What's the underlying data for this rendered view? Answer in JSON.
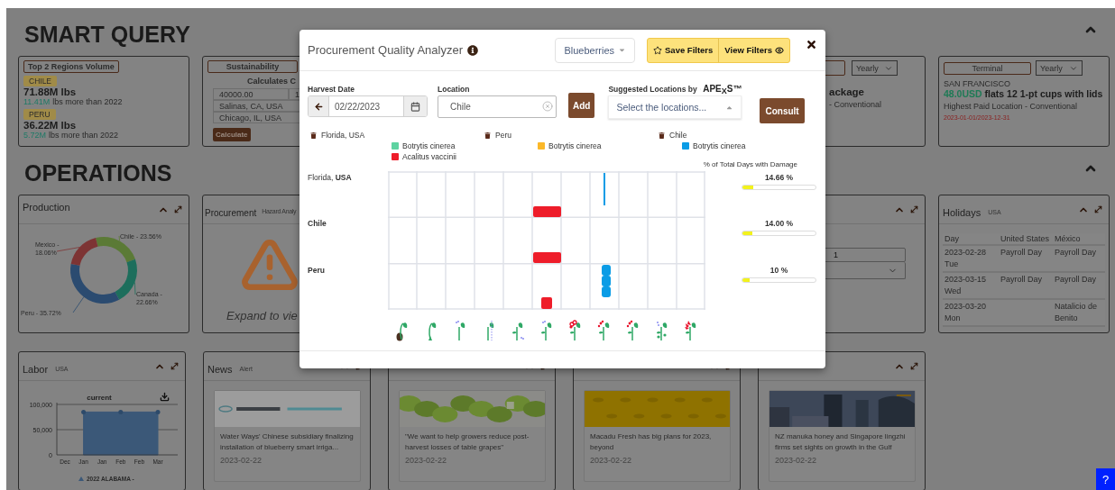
{
  "smart_query": {
    "title": "SMART QUERY",
    "volume_card": {
      "title": "Top 2 Regions Volume",
      "regions": [
        {
          "name": "CHILE",
          "volume": "71.88M lbs",
          "change": "11.41M",
          "change_text": "lbs more than 2022"
        },
        {
          "name": "PERU",
          "volume": "36.22M lbs",
          "change": "5.72M",
          "change_text": "lbs more than 2022"
        }
      ]
    },
    "sustainability_card": {
      "title": "Sustainability",
      "heading": "Calculates C",
      "amount": "40000.00",
      "count": "1",
      "origin": "Salinas, CA, USA",
      "destination": "Chicago, IL, USA",
      "button": "Calculate"
    },
    "package_card": {
      "period": "Yearly",
      "headline": "ackage",
      "subline": "- Conventional"
    },
    "terminal_card": {
      "title": "Terminal",
      "period": "Yearly",
      "city": "SAN FRANCISCO",
      "price": "48.0USD",
      "product": "flats 12 1-pt cups with lids",
      "subline": "Highest Paid Location - Conventional",
      "dates": "2023-01-01/2023-12-31"
    }
  },
  "operations": {
    "title": "OPERATIONS",
    "production": {
      "title": "Production",
      "label_separator": "-",
      "chart_data": {
        "type": "donut",
        "categories": [
          "Chile",
          "Canada",
          "Peru",
          "Mexico"
        ],
        "values": [
          23.56,
          22.66,
          35.72,
          18.06
        ],
        "value_labels": [
          "23.56%",
          "22.66%",
          "35.72%",
          "18.06%"
        ]
      }
    },
    "procurement": {
      "title": "Procurement",
      "subtitle": "Hazard Analy",
      "hint": "Expand to vie"
    },
    "settings_card": {
      "value": "1"
    },
    "holidays": {
      "title": "Holidays",
      "subtitle": "USA",
      "columns": [
        "Day",
        "United States",
        "México"
      ],
      "rows": [
        {
          "day": "2023-02-28 Tue",
          "united_states": "Payroll Day",
          "mexico": "Payroll Day"
        },
        {
          "day": "2023-03-15 Wed",
          "united_states": "Payroll Day",
          "mexico": "Payroll Day"
        },
        {
          "day": "2023-03-20 Mon",
          "mexico": "Natalicio de Benito"
        }
      ]
    }
  },
  "labor": {
    "title": "Labor",
    "subtitle": "USA",
    "chart_data": {
      "type": "area",
      "title": "current",
      "categories": [
        "Dec",
        "Jan",
        "Jan",
        "Feb",
        "Feb",
        "Mar"
      ],
      "ylim": [
        0,
        100000
      ],
      "yticks": [
        {
          "value": 0,
          "label": "0"
        },
        {
          "value": 50000,
          "label": "50,000"
        },
        {
          "value": 100000,
          "label": "100,000"
        }
      ],
      "series": [
        {
          "name": "2022 ALABAMA -",
          "color": "#3b5878",
          "values": [
            null,
            85000,
            null,
            85000,
            null,
            85000
          ]
        }
      ]
    }
  },
  "news": {
    "title": "News",
    "subtitle": "Alert",
    "items": [
      {
        "headline": "Water Ways' Chinese subsidiary finalizing installation of blueberry smart irriga...",
        "date": "2023-02-22"
      },
      {
        "headline": "\"We want to help growers reduce post-harvest losses of table grapes\"",
        "date": "2023-02-22"
      },
      {
        "headline": "Macadu Fresh has big plans for 2023, beyond",
        "date": "2023-02-22"
      },
      {
        "headline": "NZ manuka honey and Singapore lingzhi firms set sights on growth in the Gulf",
        "date": "2023-02-22"
      }
    ]
  },
  "modal": {
    "title": "Procurement Quality Analyzer",
    "crop": "Blueberries",
    "save_button": "Save Filters",
    "view_button": "View Filters",
    "harvest_date": {
      "label": "Harvest Date",
      "value": "02/22/2023"
    },
    "location": {
      "label": "Location",
      "value": "Chile"
    },
    "add_button": "Add",
    "suggested": {
      "label": "Suggested Locations by",
      "brand": "APE$_{X}$S™",
      "placeholder": "Select the locations..."
    },
    "consult_button": "Consult",
    "legend": [
      {
        "location": "Florida, USA",
        "pests": [
          {
            "name": "Botrytis cinerea",
            "color": "#5ed3a1"
          },
          {
            "name": "Acalitus vaccinii",
            "color": "#ee1d2a"
          }
        ]
      },
      {
        "location": "Peru",
        "pests": [
          {
            "name": "Botrytis cinerea",
            "color": "#fbb829"
          }
        ]
      },
      {
        "location": "Chile",
        "pests": [
          {
            "name": "Botrytis cinerea",
            "color": "#0a9ce6"
          }
        ]
      }
    ],
    "damage_heading": "% of Total Days with Damage",
    "rows": [
      {
        "place": "Florida,",
        "region": "USA",
        "reading": "14.66 %",
        "level": 0.15
      },
      {
        "region": "Chile",
        "reading": "14.00 %",
        "level": 0.14
      },
      {
        "region": "Peru",
        "reading": "10 %",
        "level": 0.1
      }
    ]
  },
  "help_button": "?"
}
